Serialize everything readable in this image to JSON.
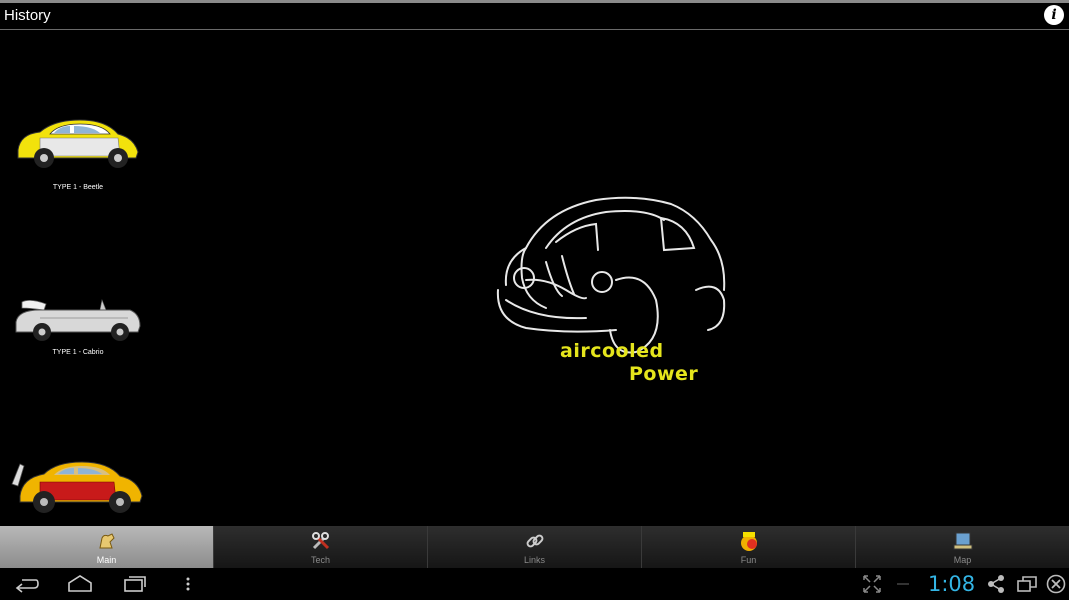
{
  "app": {
    "title": "History"
  },
  "cars": [
    {
      "label": "TYPE 1 - Beetle"
    },
    {
      "label": "TYPE 1 - Cabrio"
    }
  ],
  "logo": {
    "line1": "aircooled",
    "line2": "Power"
  },
  "tabs": [
    {
      "label": "Main",
      "icon": "main-icon",
      "active": true
    },
    {
      "label": "Tech",
      "icon": "tools-icon",
      "active": false
    },
    {
      "label": "Links",
      "icon": "chain-link-icon",
      "active": false
    },
    {
      "label": "Fun",
      "icon": "fun-icon",
      "active": false
    },
    {
      "label": "Map",
      "icon": "map-icon",
      "active": false
    }
  ],
  "system": {
    "clock": "1:08"
  },
  "colors": {
    "accent": "#33b5e5",
    "logo_text": "#e5e51c",
    "active_tab": "#a8a8a8"
  }
}
